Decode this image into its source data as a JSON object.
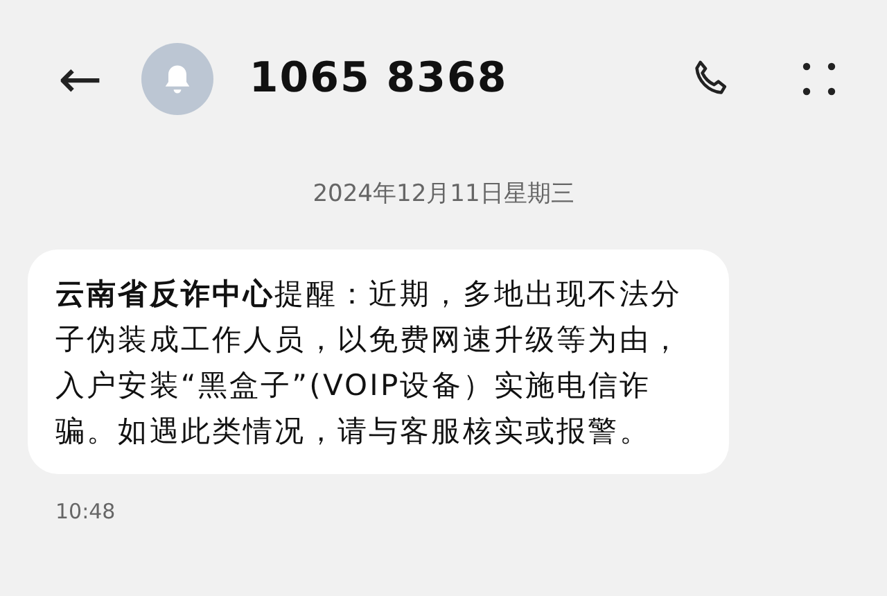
{
  "header": {
    "back": "←",
    "title": "1065 8368"
  },
  "date": "2024年12月11日星期三",
  "messages": [
    {
      "text": "**云南省反诈中心**提醒：近期，多地出现不法分子伪装成工作人员，以免费网速升级等为由，入户安装“黑盒子”(VOIP设备）实施电信诈骗。如遇此类情况，请与客服核实或报警。",
      "time": "10:48"
    }
  ]
}
